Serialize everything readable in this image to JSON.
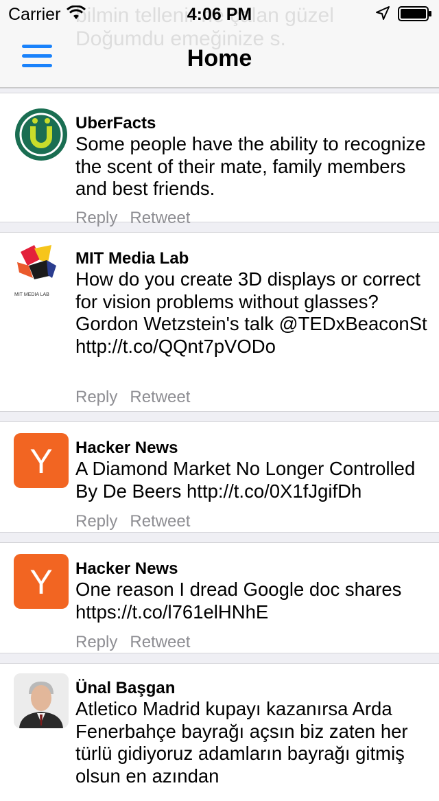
{
  "status_bar": {
    "carrier": "Carrier",
    "time": "4:06 PM",
    "wifi_icon": "wifi-icon",
    "location_icon": "location-arrow-icon",
    "battery_icon": "battery-icon"
  },
  "header": {
    "title": "Home",
    "menu_icon": "hamburger-menu-icon",
    "accent_color": "#1a82fb",
    "ghost_text_line1": "bilmin tellenir ne çalan güzel",
    "ghost_text_line2": "Doğumdu emeğinize s."
  },
  "tweets": [
    {
      "author": "UberFacts",
      "text": "Some people have the ability to recognize the scent of their mate, family members and best friends.",
      "avatar_icon": "uberfacts-logo",
      "reply_label": "Reply",
      "retweet_label": "Retweet"
    },
    {
      "author": "MIT Media Lab",
      "text": "How do you create 3D displays or correct for vision problems without glasses? Gordon Wetzstein's talk @TEDxBeaconSt http://t.co/QQnt7pVODo",
      "avatar_icon": "mit-media-lab-logo",
      "avatar_caption": "MIT MEDIA LAB",
      "reply_label": "Reply",
      "retweet_label": "Retweet"
    },
    {
      "author": "Hacker News",
      "text": "A Diamond Market No Longer Controlled By De Beers http://t.co/0X1fJgifDh",
      "avatar_icon": "hacker-news-logo",
      "avatar_letter": "Y",
      "reply_label": "Reply",
      "retweet_label": "Retweet"
    },
    {
      "author": "Hacker News",
      "text": "One reason I dread Google doc shares https://t.co/l761elHNhE",
      "avatar_icon": "hacker-news-logo",
      "avatar_letter": "Y",
      "reply_label": "Reply",
      "retweet_label": "Retweet"
    },
    {
      "author": "Ünal Başgan",
      "text": "Atletico Madrid kupayı kazanırsa Arda Fenerbahçe bayrağı açsın biz zaten her türlü gidiyoruz adamların bayrağı gitmiş olsun en azından",
      "avatar_icon": "user-photo-avatar"
    }
  ]
}
